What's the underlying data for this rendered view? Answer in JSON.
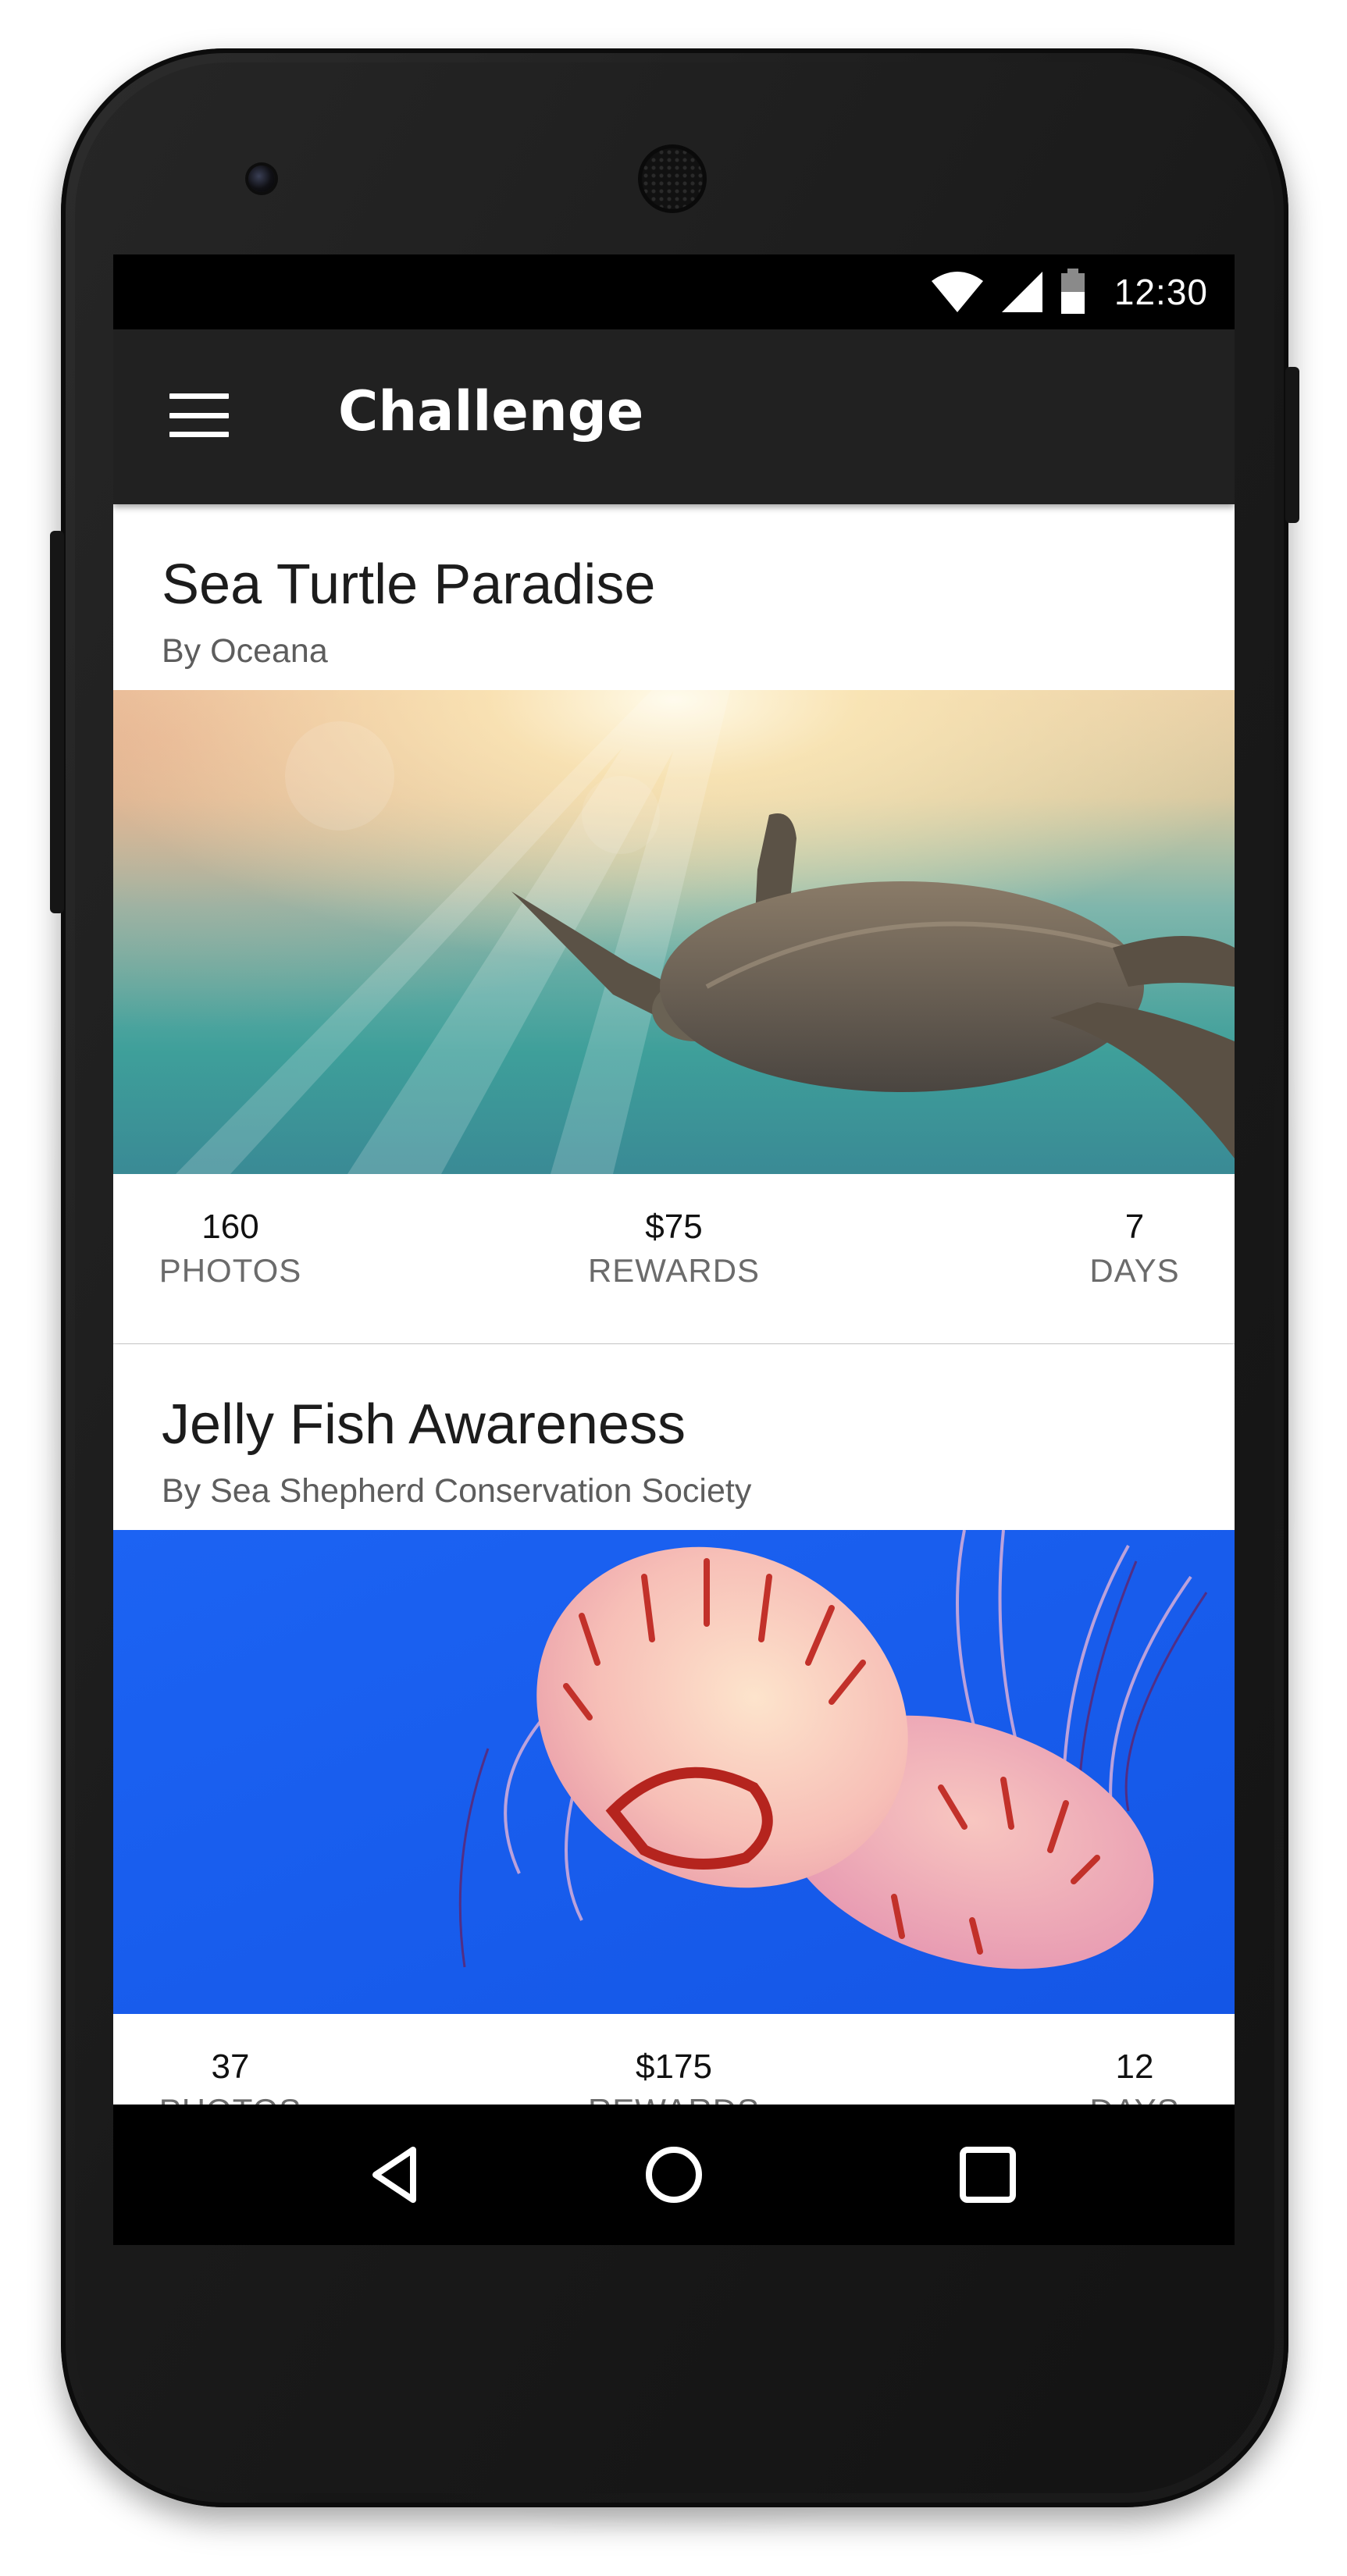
{
  "status_bar": {
    "time": "12:30",
    "icons": [
      "wifi-icon",
      "cell-signal-icon",
      "battery-icon"
    ]
  },
  "app_bar": {
    "menu_icon": "hamburger-menu-icon",
    "title": "Challenge"
  },
  "challenges": [
    {
      "title": "Sea Turtle Paradise",
      "organizer": "By Oceana",
      "image": "sea-turtle-photo",
      "stats": [
        {
          "value": "160",
          "label": "PHOTOS"
        },
        {
          "value": "$75",
          "label": "REWARDS"
        },
        {
          "value": "7",
          "label": "DAYS"
        }
      ]
    },
    {
      "title": "Jelly Fish Awareness",
      "organizer": "By Sea Shepherd Conservation Society",
      "image": "jellyfish-photo",
      "stats": [
        {
          "value": "37",
          "label": "PHOTOS"
        },
        {
          "value": "$175",
          "label": "REWARDS"
        },
        {
          "value": "12",
          "label": "DAYS"
        }
      ]
    }
  ],
  "nav_bar": {
    "buttons": [
      "back-icon",
      "home-icon",
      "recents-icon"
    ]
  },
  "colors": {
    "app_bar": "#212121",
    "status_bar": "#000000",
    "card_background": "#ffffff",
    "screen_background": "#ececec",
    "jellyfish_water": "#1a5ef2"
  }
}
